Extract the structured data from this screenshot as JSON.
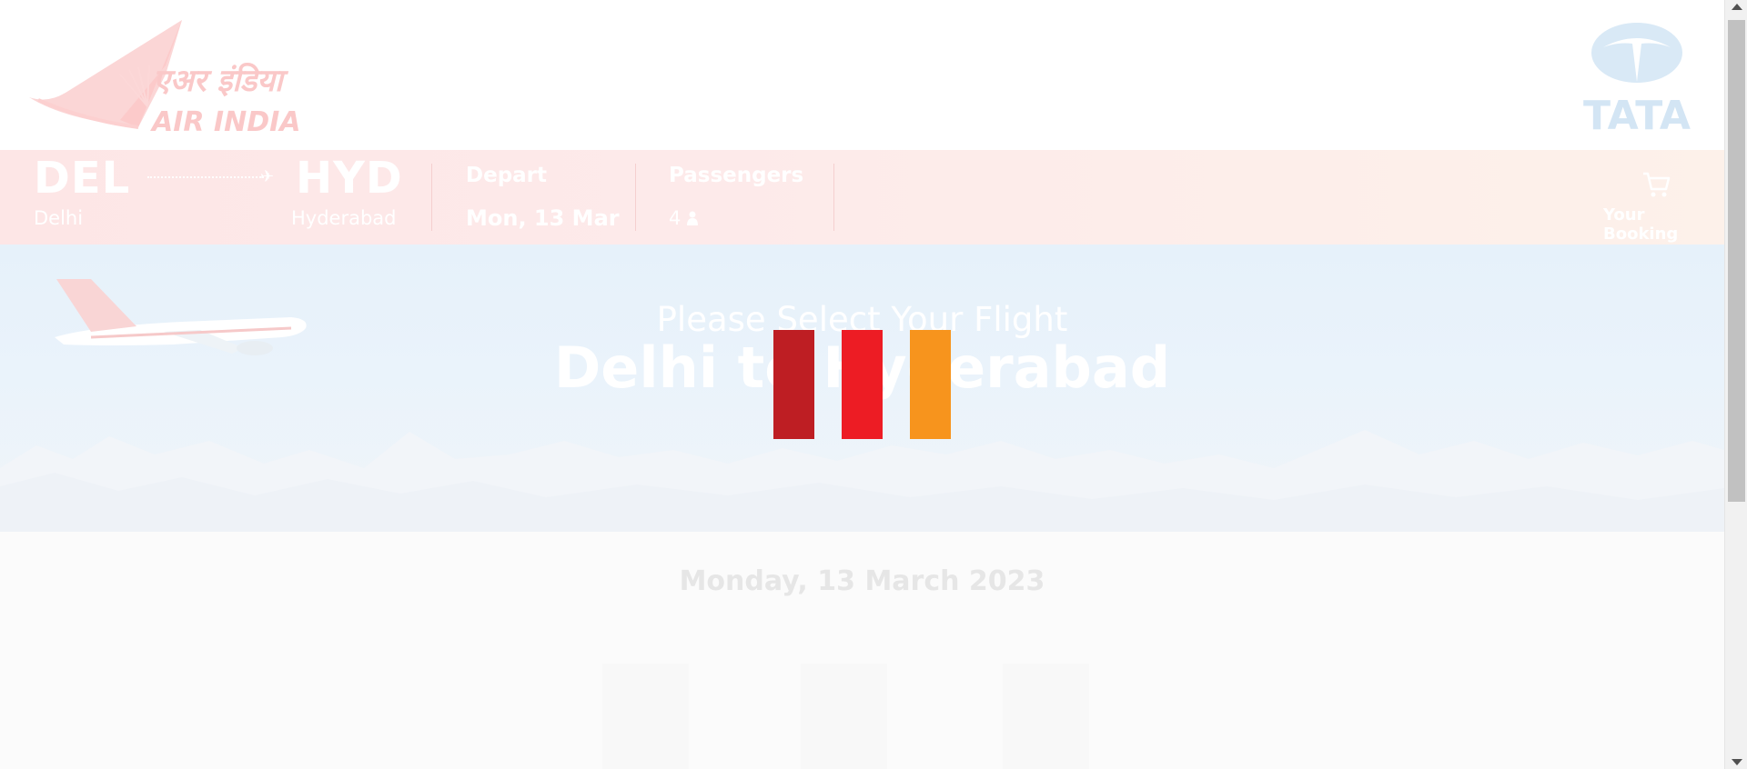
{
  "origin": {
    "code": "DEL",
    "city": "Delhi"
  },
  "destination": {
    "code": "HYD",
    "city": "Hyderabad"
  },
  "depart": {
    "label": "Depart",
    "value": "Mon, 13 Mar"
  },
  "passengers": {
    "label": "Passengers",
    "value": "4"
  },
  "booking": {
    "label": "Your Booking"
  },
  "hero": {
    "subtitle": "Please Select Your Flight",
    "title": "Delhi to Hyderabad"
  },
  "date_heading": "Monday, 13 March 2023",
  "brand": {
    "air_india": "AIR INDIA",
    "air_india_hindi": "एअर इंडिया",
    "tata": "TATA"
  },
  "colors": {
    "loader_1": "#be1e23",
    "loader_2": "#ed1c24",
    "loader_3": "#f7941d",
    "air_india_red": "#f5c6c6",
    "tata_blue": "#d6e7f5"
  },
  "icons": [
    "plane-icon",
    "person-icon",
    "cart-icon"
  ]
}
